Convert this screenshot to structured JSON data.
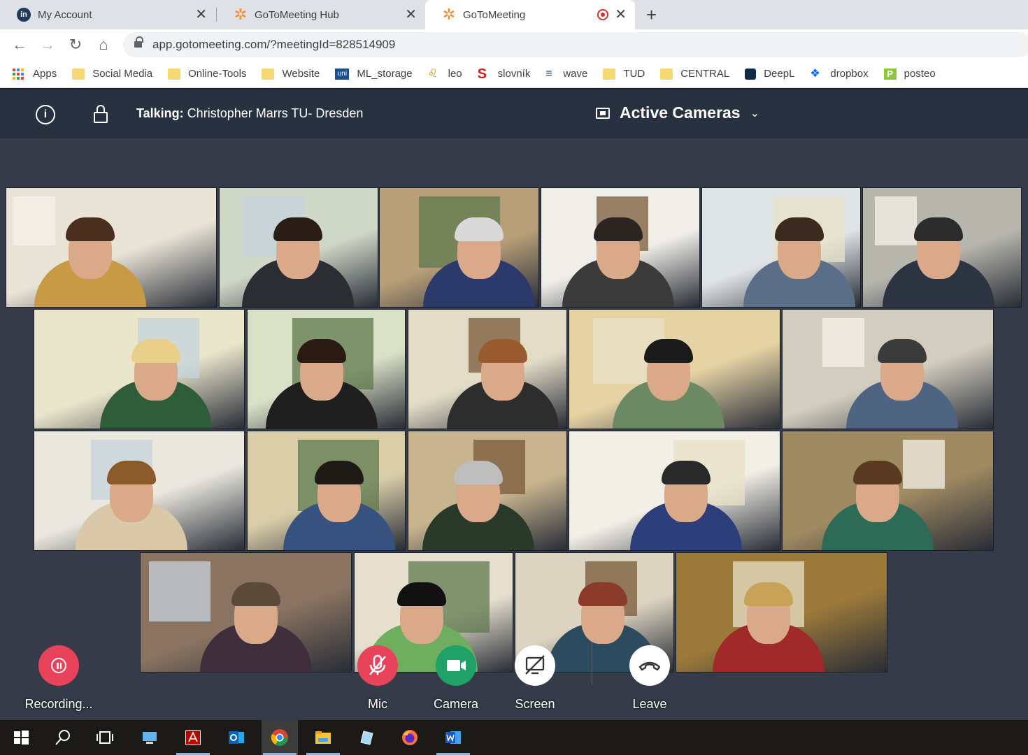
{
  "browser": {
    "tabs": [
      {
        "title": "My Account",
        "icon": "linkedin-learning-icon"
      },
      {
        "title": "GoToMeeting Hub",
        "icon": "gotomeeting-icon"
      },
      {
        "title": "GoToMeeting",
        "icon": "gotomeeting-icon",
        "recording": true,
        "active": true
      }
    ],
    "url": "app.gotomeeting.com/?meetingId=828514909",
    "bookmarks": [
      {
        "label": "Apps",
        "icon": "apps-grid-icon"
      },
      {
        "label": "Social Media",
        "icon": "folder-icon"
      },
      {
        "label": "Online-Tools",
        "icon": "folder-icon"
      },
      {
        "label": "Website",
        "icon": "folder-icon"
      },
      {
        "label": "ML_storage",
        "icon": "uni-icon"
      },
      {
        "label": "leo",
        "icon": "leo-icon"
      },
      {
        "label": "slovník",
        "icon": "slovnik-icon"
      },
      {
        "label": "wave",
        "icon": "wave-icon"
      },
      {
        "label": "TUD",
        "icon": "folder-icon"
      },
      {
        "label": "CENTRAL",
        "icon": "folder-icon"
      },
      {
        "label": "DeepL",
        "icon": "deepl-icon"
      },
      {
        "label": "dropbox",
        "icon": "dropbox-icon"
      },
      {
        "label": "posteo",
        "icon": "posteo-icon"
      }
    ]
  },
  "meeting": {
    "talking_label": "Talking:",
    "talking_name": "Christopher Marrs TU- Dresden",
    "camera_mode": "Active Cameras",
    "participant_count": 22
  },
  "controls": {
    "recording": "Recording...",
    "mic": "Mic",
    "camera": "Camera",
    "screen": "Screen",
    "leave": "Leave"
  },
  "colors": {
    "header_bg": "#283140",
    "stage_bg": "#353b48",
    "mic_off": "#e9435c",
    "camera_on": "#1fa168",
    "brand": "#f68d2e"
  },
  "taskbar": [
    "windows-start-icon",
    "search-icon",
    "task-view-icon",
    "this-pc-icon",
    "acrobat-icon",
    "outlook-icon",
    "chrome-icon",
    "file-explorer-icon",
    "snipping-tool-icon",
    "firefox-icon",
    "word-icon"
  ]
}
